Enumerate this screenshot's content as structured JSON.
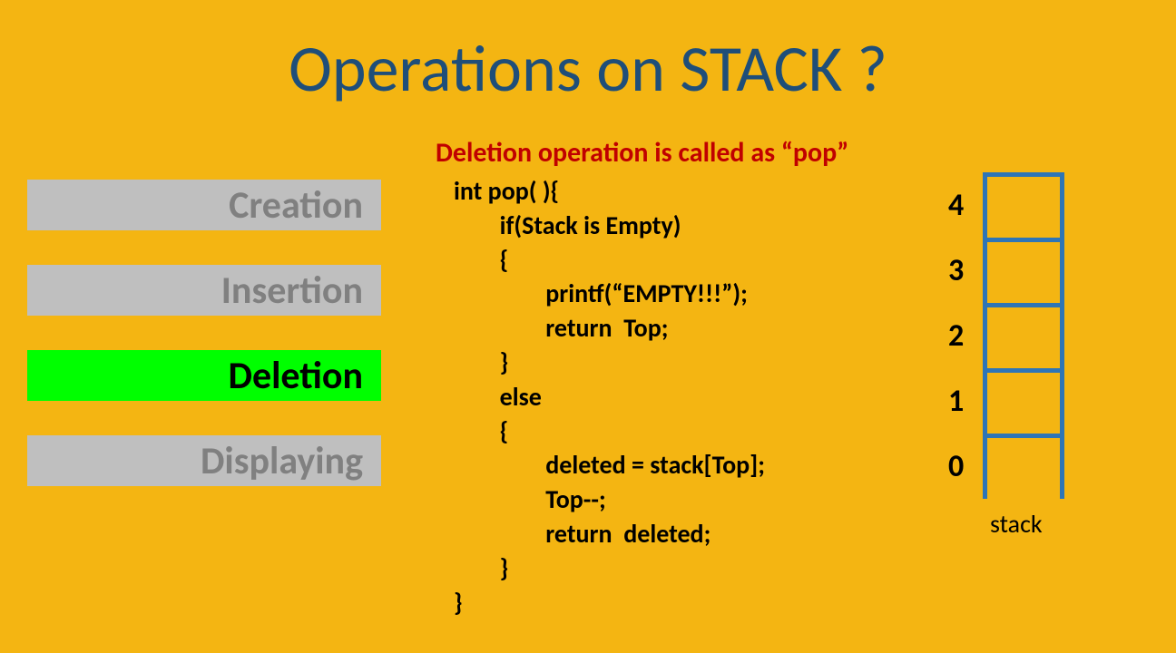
{
  "title": "Operations on STACK ?",
  "ops": {
    "creation": "Creation",
    "insertion": "Insertion",
    "deletion": "Deletion",
    "displaying": "Displaying"
  },
  "subtitle": "Deletion operation is called as “pop”",
  "code": "int pop( ){\n        if(Stack is Empty)\n        {\n                printf(“EMPTY!!!”);\n                return  Top;\n        }\n        else\n        {\n                deleted = stack[Top];\n                Top--;\n                return  deleted;\n        }\n}",
  "stack": {
    "indices": [
      "4",
      "3",
      "2",
      "1",
      "0"
    ],
    "label": "stack"
  }
}
